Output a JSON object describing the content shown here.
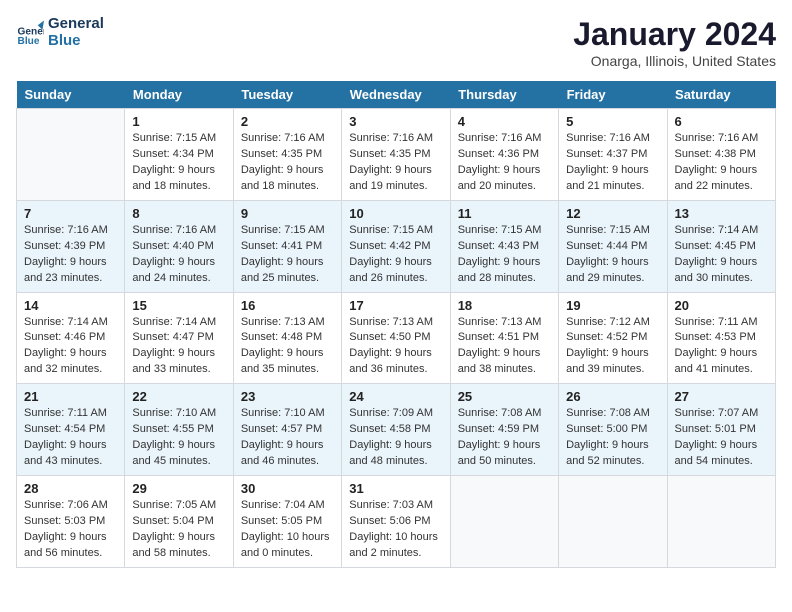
{
  "header": {
    "logo_line1": "General",
    "logo_line2": "Blue",
    "month": "January 2024",
    "location": "Onarga, Illinois, United States"
  },
  "days_of_week": [
    "Sunday",
    "Monday",
    "Tuesday",
    "Wednesday",
    "Thursday",
    "Friday",
    "Saturday"
  ],
  "weeks": [
    [
      {
        "num": "",
        "info": ""
      },
      {
        "num": "1",
        "info": "Sunrise: 7:15 AM\nSunset: 4:34 PM\nDaylight: 9 hours\nand 18 minutes."
      },
      {
        "num": "2",
        "info": "Sunrise: 7:16 AM\nSunset: 4:35 PM\nDaylight: 9 hours\nand 18 minutes."
      },
      {
        "num": "3",
        "info": "Sunrise: 7:16 AM\nSunset: 4:35 PM\nDaylight: 9 hours\nand 19 minutes."
      },
      {
        "num": "4",
        "info": "Sunrise: 7:16 AM\nSunset: 4:36 PM\nDaylight: 9 hours\nand 20 minutes."
      },
      {
        "num": "5",
        "info": "Sunrise: 7:16 AM\nSunset: 4:37 PM\nDaylight: 9 hours\nand 21 minutes."
      },
      {
        "num": "6",
        "info": "Sunrise: 7:16 AM\nSunset: 4:38 PM\nDaylight: 9 hours\nand 22 minutes."
      }
    ],
    [
      {
        "num": "7",
        "info": "Sunrise: 7:16 AM\nSunset: 4:39 PM\nDaylight: 9 hours\nand 23 minutes."
      },
      {
        "num": "8",
        "info": "Sunrise: 7:16 AM\nSunset: 4:40 PM\nDaylight: 9 hours\nand 24 minutes."
      },
      {
        "num": "9",
        "info": "Sunrise: 7:15 AM\nSunset: 4:41 PM\nDaylight: 9 hours\nand 25 minutes."
      },
      {
        "num": "10",
        "info": "Sunrise: 7:15 AM\nSunset: 4:42 PM\nDaylight: 9 hours\nand 26 minutes."
      },
      {
        "num": "11",
        "info": "Sunrise: 7:15 AM\nSunset: 4:43 PM\nDaylight: 9 hours\nand 28 minutes."
      },
      {
        "num": "12",
        "info": "Sunrise: 7:15 AM\nSunset: 4:44 PM\nDaylight: 9 hours\nand 29 minutes."
      },
      {
        "num": "13",
        "info": "Sunrise: 7:14 AM\nSunset: 4:45 PM\nDaylight: 9 hours\nand 30 minutes."
      }
    ],
    [
      {
        "num": "14",
        "info": "Sunrise: 7:14 AM\nSunset: 4:46 PM\nDaylight: 9 hours\nand 32 minutes."
      },
      {
        "num": "15",
        "info": "Sunrise: 7:14 AM\nSunset: 4:47 PM\nDaylight: 9 hours\nand 33 minutes."
      },
      {
        "num": "16",
        "info": "Sunrise: 7:13 AM\nSunset: 4:48 PM\nDaylight: 9 hours\nand 35 minutes."
      },
      {
        "num": "17",
        "info": "Sunrise: 7:13 AM\nSunset: 4:50 PM\nDaylight: 9 hours\nand 36 minutes."
      },
      {
        "num": "18",
        "info": "Sunrise: 7:13 AM\nSunset: 4:51 PM\nDaylight: 9 hours\nand 38 minutes."
      },
      {
        "num": "19",
        "info": "Sunrise: 7:12 AM\nSunset: 4:52 PM\nDaylight: 9 hours\nand 39 minutes."
      },
      {
        "num": "20",
        "info": "Sunrise: 7:11 AM\nSunset: 4:53 PM\nDaylight: 9 hours\nand 41 minutes."
      }
    ],
    [
      {
        "num": "21",
        "info": "Sunrise: 7:11 AM\nSunset: 4:54 PM\nDaylight: 9 hours\nand 43 minutes."
      },
      {
        "num": "22",
        "info": "Sunrise: 7:10 AM\nSunset: 4:55 PM\nDaylight: 9 hours\nand 45 minutes."
      },
      {
        "num": "23",
        "info": "Sunrise: 7:10 AM\nSunset: 4:57 PM\nDaylight: 9 hours\nand 46 minutes."
      },
      {
        "num": "24",
        "info": "Sunrise: 7:09 AM\nSunset: 4:58 PM\nDaylight: 9 hours\nand 48 minutes."
      },
      {
        "num": "25",
        "info": "Sunrise: 7:08 AM\nSunset: 4:59 PM\nDaylight: 9 hours\nand 50 minutes."
      },
      {
        "num": "26",
        "info": "Sunrise: 7:08 AM\nSunset: 5:00 PM\nDaylight: 9 hours\nand 52 minutes."
      },
      {
        "num": "27",
        "info": "Sunrise: 7:07 AM\nSunset: 5:01 PM\nDaylight: 9 hours\nand 54 minutes."
      }
    ],
    [
      {
        "num": "28",
        "info": "Sunrise: 7:06 AM\nSunset: 5:03 PM\nDaylight: 9 hours\nand 56 minutes."
      },
      {
        "num": "29",
        "info": "Sunrise: 7:05 AM\nSunset: 5:04 PM\nDaylight: 9 hours\nand 58 minutes."
      },
      {
        "num": "30",
        "info": "Sunrise: 7:04 AM\nSunset: 5:05 PM\nDaylight: 10 hours\nand 0 minutes."
      },
      {
        "num": "31",
        "info": "Sunrise: 7:03 AM\nSunset: 5:06 PM\nDaylight: 10 hours\nand 2 minutes."
      },
      {
        "num": "",
        "info": ""
      },
      {
        "num": "",
        "info": ""
      },
      {
        "num": "",
        "info": ""
      }
    ]
  ]
}
